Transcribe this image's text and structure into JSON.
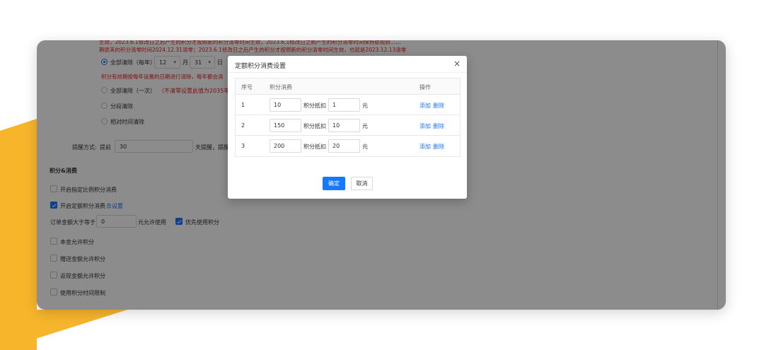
{
  "background": {
    "yellow_color": "#f7b52c",
    "frame_color": "#ffffff"
  },
  "settings": {
    "notice_line1": "生效，2023.6.1修改日之后产生的积分才按照新的积分清零时间生效，2023.6.1修改日之前产生的积分清零时间保持原规则……",
    "notice_line2": "期原来的积分清零时间2024.12.31清零；2023.6.1修改日之后产生的积分才按照新的积分清零时间生效，也就是2023.12.13清零",
    "clear_options": {
      "yearly_label": "全部清除（每年）",
      "month_value": "12",
      "month_unit": "月",
      "day_value": "31",
      "day_unit": "日",
      "yearly_note": "积分有效期按每年设置的日期进行清除，每年都会清",
      "once_label": "全部清除（一次）",
      "once_note": "（不清零设置此值为2035年）",
      "segment_label": "分段清除",
      "relative_label": "相对时间清除"
    },
    "reminder": {
      "label": "提醒方式:",
      "prefix": "提前",
      "days_value": "30",
      "suffix": "天提醒，提醒"
    },
    "section_title": "积分&消费",
    "options": {
      "custom_ratio_label": "开启指定比例积分消费",
      "fixed_consume_label": "开启定额积分消费",
      "fixed_consume_link": "去设置",
      "order_min_prefix": "订单金额大于等于",
      "order_min_value": "0",
      "order_min_suffix": "元允许使用",
      "priority_label": "优先使用积分",
      "principal_label": "本金允许积分",
      "gift_label": "赠送金额允许积分",
      "cashback_label": "返现金额允许积分",
      "time_limit_label": "使用积分时间限制"
    }
  },
  "dialog": {
    "title": "定额积分消费设置",
    "close_icon": "close-icon",
    "headers": {
      "index": "序号",
      "consume": "积分消费",
      "actions": "操作"
    },
    "rows": [
      {
        "index": "1",
        "points": "10",
        "mid_label": "积分抵扣",
        "amount": "1",
        "unit": "元",
        "add": "添加",
        "delete": "删除"
      },
      {
        "index": "2",
        "points": "150",
        "mid_label": "积分抵扣",
        "amount": "10",
        "unit": "元",
        "add": "添加",
        "delete": "删除"
      },
      {
        "index": "3",
        "points": "200",
        "mid_label": "积分抵扣",
        "amount": "20",
        "unit": "元",
        "add": "添加",
        "delete": "删除"
      }
    ],
    "ok_label": "确定",
    "cancel_label": "取消"
  }
}
